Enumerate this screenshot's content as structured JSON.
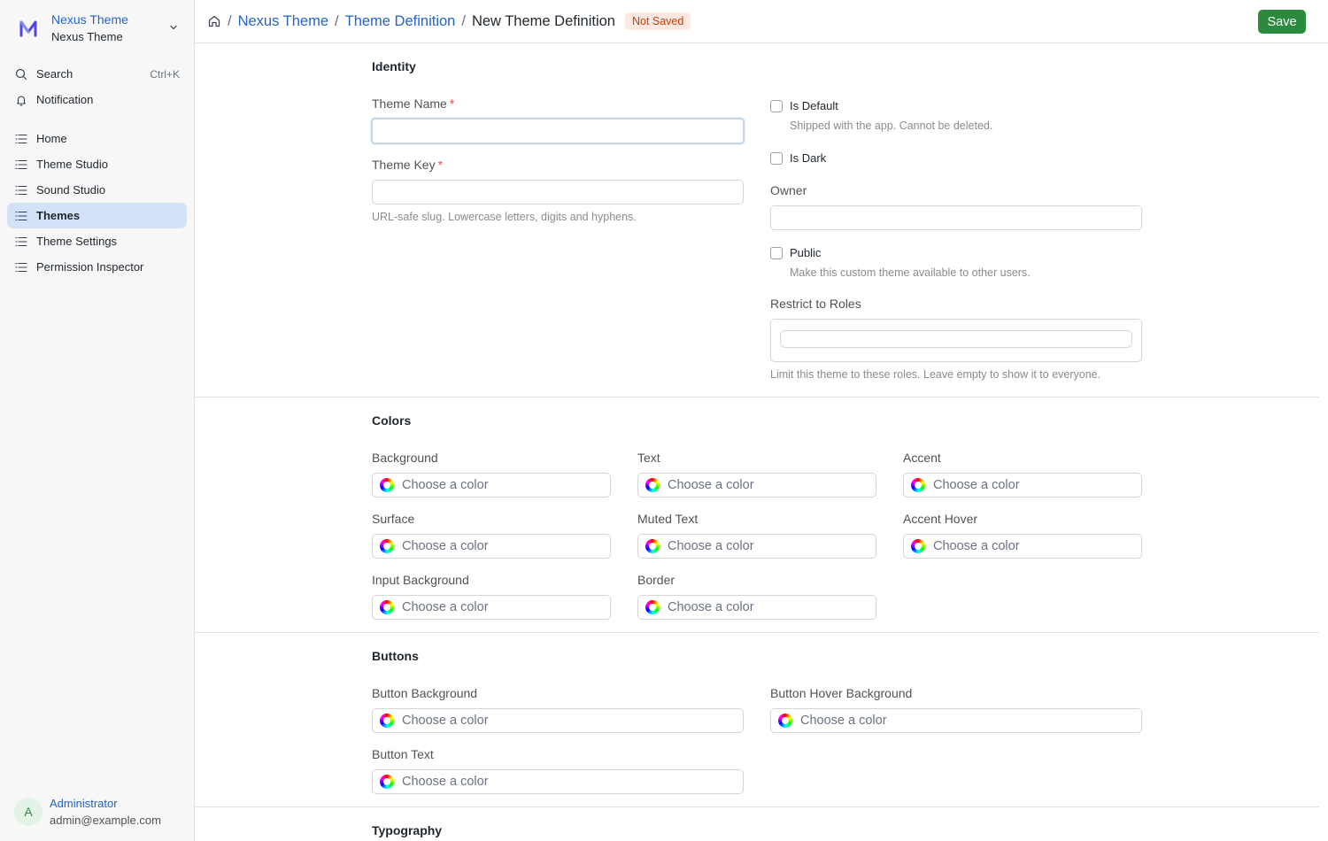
{
  "sidebar": {
    "brand_title": "Nexus Theme",
    "brand_subtitle": "Nexus Theme",
    "search_label": "Search",
    "search_shortcut": "Ctrl+K",
    "notification_label": "Notification",
    "items": [
      {
        "label": "Home"
      },
      {
        "label": "Theme Studio"
      },
      {
        "label": "Sound Studio"
      },
      {
        "label": "Themes"
      },
      {
        "label": "Theme Settings"
      },
      {
        "label": "Permission Inspector"
      }
    ],
    "active_item": "Themes",
    "user": {
      "initial": "A",
      "name": "Administrator",
      "email": "admin@example.com"
    }
  },
  "header": {
    "breadcrumbs": [
      "Nexus Theme",
      "Theme Definition"
    ],
    "current": "New Theme Definition",
    "status_badge": "Not Saved",
    "save_label": "Save"
  },
  "identity": {
    "title": "Identity",
    "theme_name_label": "Theme Name",
    "theme_key_label": "Theme Key",
    "theme_key_help": "URL-safe slug. Lowercase letters, digits and hyphens.",
    "is_default_label": "Is Default",
    "is_default_help": "Shipped with the app. Cannot be deleted.",
    "is_dark_label": "Is Dark",
    "owner_label": "Owner",
    "public_label": "Public",
    "public_help": "Make this custom theme available to other users.",
    "restrict_label": "Restrict to Roles",
    "restrict_help": "Limit this theme to these roles. Leave empty to show it to everyone."
  },
  "colors": {
    "title": "Colors",
    "placeholder": "Choose a color",
    "fields": [
      "Background",
      "Text",
      "Accent",
      "Surface",
      "Muted Text",
      "Accent Hover",
      "Input Background",
      "Border"
    ]
  },
  "buttons": {
    "title": "Buttons",
    "placeholder": "Choose a color",
    "fields": [
      "Button Background",
      "Button Hover Background",
      "Button Text"
    ]
  },
  "typography": {
    "title": "Typography"
  },
  "palette": {
    "accent": "#2563c9",
    "save_button": "#2b8a3e",
    "badge_bg": "#fde8e1",
    "badge_text": "#c2410c",
    "active_nav": "#d3e2f6"
  }
}
